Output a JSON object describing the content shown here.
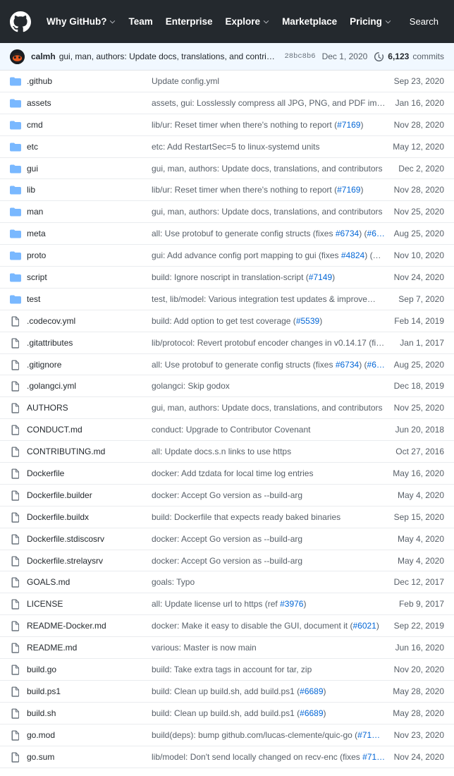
{
  "nav": {
    "logo_icon": "github-mark-icon",
    "items": [
      {
        "label": "Why GitHub?",
        "has_caret": true
      },
      {
        "label": "Team",
        "has_caret": false
      },
      {
        "label": "Enterprise",
        "has_caret": false
      },
      {
        "label": "Explore",
        "has_caret": true
      },
      {
        "label": "Marketplace",
        "has_caret": false
      },
      {
        "label": "Pricing",
        "has_caret": true
      }
    ],
    "search_label": "Search"
  },
  "commit_bar": {
    "avatar_icon": "user-avatar",
    "author": "calmh",
    "message": "gui, man, authors: Update docs, translations, and contributors",
    "sha": "28bc8b6",
    "date": "Dec 1, 2020",
    "history_icon": "history-clock-icon",
    "commits_count": "6,123",
    "commits_label": "commits"
  },
  "colors": {
    "nav_background": "#24292e",
    "commit_bar_background": "#f1f8ff",
    "link": "#0366d6",
    "folder_icon": "#79b8ff",
    "file_icon": "#6a737d",
    "row_border": "#eaecef",
    "text_primary": "#24292e",
    "text_muted": "#586069"
  },
  "files": [
    {
      "type": "folder",
      "name": ".github",
      "message_parts": [
        {
          "t": "Update config.yml"
        }
      ],
      "date": "Sep 23, 2020"
    },
    {
      "type": "folder",
      "name": "assets",
      "message_parts": [
        {
          "t": "assets, gui: Losslessly compress all JPG, PNG, and PDF image…"
        }
      ],
      "date": "Jan 16, 2020"
    },
    {
      "type": "folder",
      "name": "cmd",
      "message_parts": [
        {
          "t": "lib/ur: Reset timer when there's nothing to report ("
        },
        {
          "t": "#7169",
          "k": "link"
        },
        {
          "t": ")"
        }
      ],
      "date": "Nov 28, 2020"
    },
    {
      "type": "folder",
      "name": "etc",
      "message_parts": [
        {
          "t": "etc: Add RestartSec=5 to linux-systemd units"
        }
      ],
      "date": "May 12, 2020"
    },
    {
      "type": "folder",
      "name": "gui",
      "message_parts": [
        {
          "t": "gui, man, authors: Update docs, translations, and contributors"
        }
      ],
      "date": "Dec 2, 2020"
    },
    {
      "type": "folder",
      "name": "lib",
      "message_parts": [
        {
          "t": "lib/ur: Reset timer when there's nothing to report ("
        },
        {
          "t": "#7169",
          "k": "link"
        },
        {
          "t": ")"
        }
      ],
      "date": "Nov 28, 2020"
    },
    {
      "type": "folder",
      "name": "man",
      "message_parts": [
        {
          "t": "gui, man, authors: Update docs, translations, and contributors"
        }
      ],
      "date": "Nov 25, 2020"
    },
    {
      "type": "folder",
      "name": "meta",
      "message_parts": [
        {
          "t": "all: Use protobuf to generate config structs ("
        },
        {
          "t": "fixes",
          "k": "abbr"
        },
        {
          "t": " "
        },
        {
          "t": "#6734",
          "k": "link"
        },
        {
          "t": ") ("
        },
        {
          "t": "#6…",
          "k": "link"
        }
      ],
      "date": "Aug 25, 2020"
    },
    {
      "type": "folder",
      "name": "proto",
      "message_parts": [
        {
          "t": "gui: Add advance config port mapping to gui ("
        },
        {
          "t": "fixes",
          "k": "abbr"
        },
        {
          "t": " "
        },
        {
          "t": "#4824",
          "k": "link"
        },
        {
          "t": ") (…"
        }
      ],
      "date": "Nov 10, 2020"
    },
    {
      "type": "folder",
      "name": "script",
      "message_parts": [
        {
          "t": "build: Ignore noscript in translation-script ("
        },
        {
          "t": "#7149",
          "k": "link"
        },
        {
          "t": ")"
        }
      ],
      "date": "Nov 24, 2020"
    },
    {
      "type": "folder",
      "name": "test",
      "message_parts": [
        {
          "t": "test, lib/model: Various integration test updates & improve…"
        }
      ],
      "date": "Sep 7, 2020"
    },
    {
      "type": "file",
      "name": ".codecov.yml",
      "message_parts": [
        {
          "t": "build: Add option to get test coverage ("
        },
        {
          "t": "#5539",
          "k": "link"
        },
        {
          "t": ")"
        }
      ],
      "date": "Feb 14, 2019"
    },
    {
      "type": "file",
      "name": ".gitattributes",
      "message_parts": [
        {
          "t": "lib/protocol: Revert protobuf encoder changes in v0.14.17 ("
        },
        {
          "t": "fi…",
          "k": "abbr"
        }
      ],
      "date": "Jan 1, 2017"
    },
    {
      "type": "file",
      "name": ".gitignore",
      "message_parts": [
        {
          "t": "all: Use protobuf to generate config structs ("
        },
        {
          "t": "fixes",
          "k": "abbr"
        },
        {
          "t": " "
        },
        {
          "t": "#6734",
          "k": "link"
        },
        {
          "t": ") ("
        },
        {
          "t": "#6…",
          "k": "link"
        }
      ],
      "date": "Aug 25, 2020"
    },
    {
      "type": "file",
      "name": ".golangci.yml",
      "message_parts": [
        {
          "t": "golangci: Skip godox"
        }
      ],
      "date": "Dec 18, 2019"
    },
    {
      "type": "file",
      "name": "AUTHORS",
      "message_parts": [
        {
          "t": "gui, man, authors: Update docs, translations, and contributors"
        }
      ],
      "date": "Nov 25, 2020"
    },
    {
      "type": "file",
      "name": "CONDUCT.md",
      "message_parts": [
        {
          "t": "conduct: Upgrade to Contributor Covenant"
        }
      ],
      "date": "Jun 20, 2018"
    },
    {
      "type": "file",
      "name": "CONTRIBUTING.md",
      "message_parts": [
        {
          "t": "all: Update docs.s.n links to use https"
        }
      ],
      "date": "Oct 27, 2016"
    },
    {
      "type": "file",
      "name": "Dockerfile",
      "message_parts": [
        {
          "t": "docker: Add tzdata for local time log entries"
        }
      ],
      "date": "May 16, 2020"
    },
    {
      "type": "file",
      "name": "Dockerfile.builder",
      "message_parts": [
        {
          "t": "docker: Accept Go version as --build-arg"
        }
      ],
      "date": "May 4, 2020"
    },
    {
      "type": "file",
      "name": "Dockerfile.buildx",
      "message_parts": [
        {
          "t": "build: Dockerfile that expects ready baked binaries"
        }
      ],
      "date": "Sep 15, 2020"
    },
    {
      "type": "file",
      "name": "Dockerfile.stdiscosrv",
      "message_parts": [
        {
          "t": "docker: Accept Go version as --build-arg"
        }
      ],
      "date": "May 4, 2020"
    },
    {
      "type": "file",
      "name": "Dockerfile.strelaysrv",
      "message_parts": [
        {
          "t": "docker: Accept Go version as --build-arg"
        }
      ],
      "date": "May 4, 2020"
    },
    {
      "type": "file",
      "name": "GOALS.md",
      "message_parts": [
        {
          "t": "goals: Typo"
        }
      ],
      "date": "Dec 12, 2017"
    },
    {
      "type": "file",
      "name": "LICENSE",
      "message_parts": [
        {
          "t": "all: Update license url to https (ref "
        },
        {
          "t": "#3976",
          "k": "link"
        },
        {
          "t": ")"
        }
      ],
      "date": "Feb 9, 2017"
    },
    {
      "type": "file",
      "name": "README-Docker.md",
      "message_parts": [
        {
          "t": "docker: Make it easy to disable the GUI, document it ("
        },
        {
          "t": "#6021",
          "k": "link"
        },
        {
          "t": ")"
        }
      ],
      "date": "Sep 22, 2019"
    },
    {
      "type": "file",
      "name": "README.md",
      "message_parts": [
        {
          "t": "various: Master is now main"
        }
      ],
      "date": "Jun 16, 2020"
    },
    {
      "type": "file",
      "name": "build.go",
      "message_parts": [
        {
          "t": "build: Take extra tags in account for tar, zip"
        }
      ],
      "date": "Nov 20, 2020"
    },
    {
      "type": "file",
      "name": "build.ps1",
      "message_parts": [
        {
          "t": "build: Clean up build.sh, add build.ps1 ("
        },
        {
          "t": "#6689",
          "k": "link"
        },
        {
          "t": ")"
        }
      ],
      "date": "May 28, 2020"
    },
    {
      "type": "file",
      "name": "build.sh",
      "message_parts": [
        {
          "t": "build: Clean up build.sh, add build.ps1 ("
        },
        {
          "t": "#6689",
          "k": "link"
        },
        {
          "t": ")"
        }
      ],
      "date": "May 28, 2020"
    },
    {
      "type": "file",
      "name": "go.mod",
      "message_parts": [
        {
          "t": "build(deps): bump github.com/lucas-clemente/quic-go ("
        },
        {
          "t": "#71…",
          "k": "link"
        }
      ],
      "date": "Nov 23, 2020"
    },
    {
      "type": "file",
      "name": "go.sum",
      "message_parts": [
        {
          "t": "lib/model: Don't send locally changed on recv-enc ("
        },
        {
          "t": "fixes",
          "k": "abbr"
        },
        {
          "t": " "
        },
        {
          "t": "#71…",
          "k": "link"
        }
      ],
      "date": "Nov 24, 2020"
    }
  ]
}
